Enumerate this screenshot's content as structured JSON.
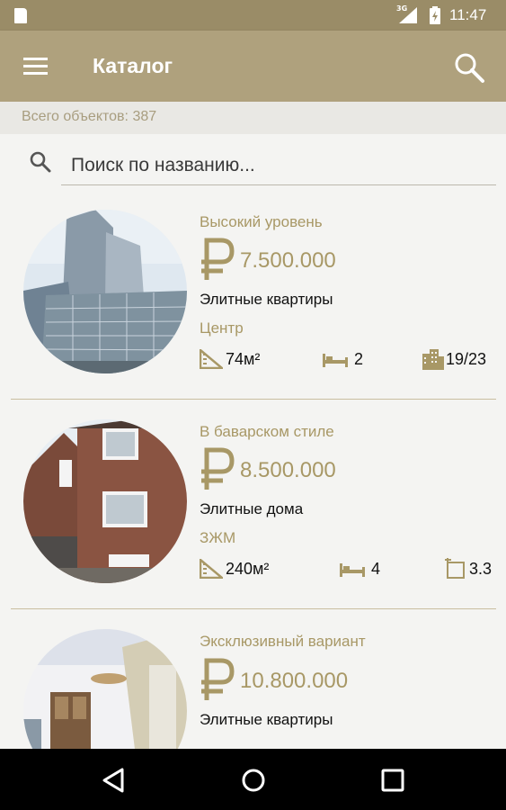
{
  "status_bar": {
    "time": "11:47",
    "network": "3G",
    "icons": [
      "sd-card-icon",
      "signal-icon",
      "battery-icon"
    ]
  },
  "app_bar": {
    "title": "Каталог",
    "menu_icon": "menu-icon",
    "search_icon": "search-icon"
  },
  "count": {
    "text": "Всего объектов: 387"
  },
  "search": {
    "placeholder": "Поиск по названию..."
  },
  "items": [
    {
      "subtitle": "Высокий уровень",
      "price": "7.500.000",
      "type": "Элитные квартиры",
      "district": "Центр",
      "area": "74м²",
      "rooms": "2",
      "floor": "19/23",
      "floor_icon": "building-icon"
    },
    {
      "subtitle": "В баварском стиле",
      "price": "8.500.000",
      "type": "Элитные дома",
      "district": "ЗЖМ",
      "area": "240м²",
      "rooms": "4",
      "floor": "3.3",
      "floor_icon": "plot-icon"
    },
    {
      "subtitle": "Эксклюзивный вариант",
      "price": "10.800.000",
      "type": "Элитные квартиры"
    }
  ],
  "colors": {
    "status_bar": "#9a8c67",
    "app_bar": "#afa17d",
    "accent": "#a89866",
    "background": "#f4f4f2"
  },
  "nav_bar": {
    "icons": [
      "back-icon",
      "home-icon",
      "recents-icon"
    ]
  }
}
